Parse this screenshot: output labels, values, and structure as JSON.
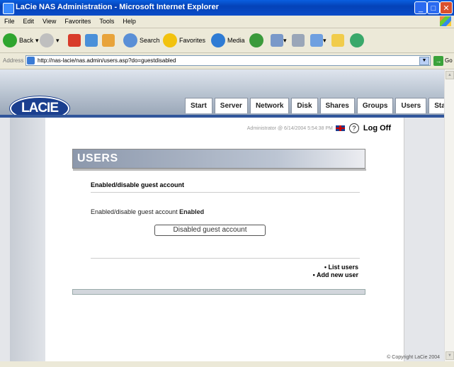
{
  "window": {
    "title": "LaCie NAS Administration - Microsoft Internet Explorer"
  },
  "menu": [
    "File",
    "Edit",
    "View",
    "Favorites",
    "Tools",
    "Help"
  ],
  "toolbar": {
    "back": "Back",
    "search": "Search",
    "favorites": "Favorites",
    "media": "Media"
  },
  "address": {
    "label": "Address",
    "url": "http://nas-lacie/nas.admin/users.asp?do=guestdisabled",
    "go": "Go"
  },
  "header": {
    "logo": "LACIE",
    "tabs": [
      "Start",
      "Server",
      "Network",
      "Disk",
      "Shares",
      "Groups",
      "Users",
      "Status"
    ]
  },
  "status_line": {
    "admin": "Administrator @ 6/14/2004 5:54:38 PM",
    "logoff": "Log Off"
  },
  "page": {
    "heading": "USERS",
    "section_title": "Enabled/disable guest account",
    "status_label": "Enabled/disable guest account",
    "status_value": "Enabled",
    "button": "Disabled guest account",
    "links": [
      "• List users",
      "• Add new user"
    ],
    "copyright": "© Copyright LaCie 2004"
  }
}
